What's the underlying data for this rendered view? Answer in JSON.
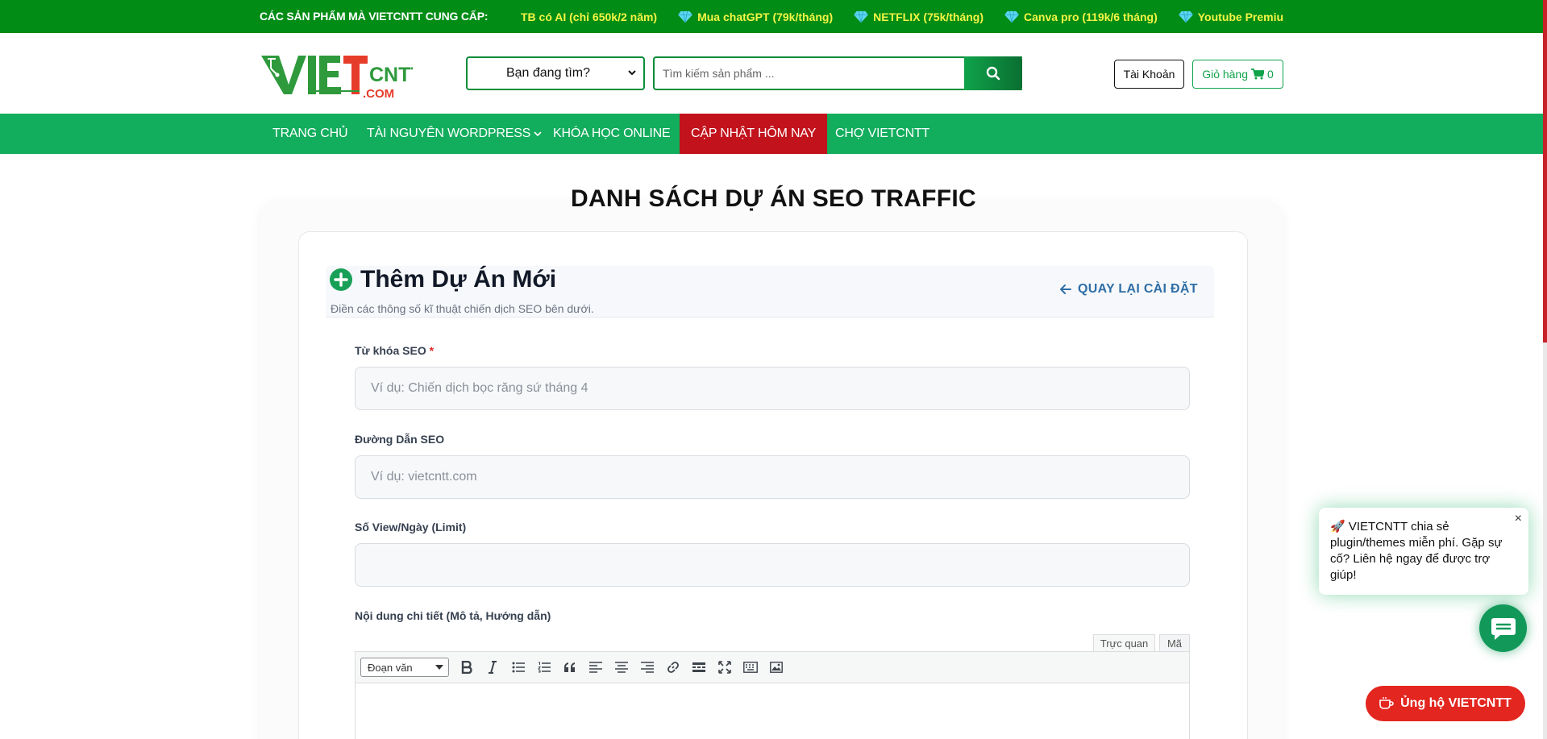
{
  "topbar": {
    "label": "CÁC SẢN PHẨM MÀ VIETCNTT CUNG CẤP:",
    "ticker": [
      "TB có AI (chỉ 650k/2 năm)",
      "Mua chatGPT (79k/tháng)",
      "NETFLIX (75k/tháng)",
      "Canva pro (119k/6 tháng)",
      "Youtube Premiu"
    ]
  },
  "header": {
    "logo_text": "VIETCNTT",
    "logo_sub": ".COM",
    "search_category": "Bạn đang tìm?",
    "search_placeholder": "Tìm kiếm sản phẩm ...",
    "account_label": "Tài Khoản",
    "cart_label": "Giỏ hàng",
    "cart_count": "0"
  },
  "nav": {
    "items": [
      "TRANG CHỦ",
      "TÀI NGUYÊN WORDPRESS",
      "KHÓA HỌC ONLINE",
      "CẬP NHẬT HÔM NAY",
      "CHỢ VIETCNTT"
    ]
  },
  "main": {
    "page_title": "DANH SÁCH DỰ ÁN SEO TRAFFIC",
    "add_title": "Thêm Dự Án Mới",
    "add_subtitle": "Điền các thông số kĩ thuật chiến dịch SEO bên dưới.",
    "back_label": "QUAY LẠI CÀI ĐẶT",
    "fields": {
      "keyword_label": "Từ khóa SEO",
      "keyword_required": "*",
      "keyword_placeholder": "Ví dụ: Chiến dịch bọc răng sứ tháng 4",
      "url_label": "Đường Dẫn SEO",
      "url_placeholder": "Ví dụ: vietcntt.com",
      "views_label": "Số View/Ngày (Limit)",
      "views_value": "",
      "content_label": "Nội dung chi tiết (Mô tả, Hướng dẫn)"
    },
    "editor": {
      "tab_visual": "Trực quan",
      "tab_code": "Mã",
      "format": "Đoạn văn"
    }
  },
  "chat": {
    "message": "🚀 VIETCNTT chia sẻ plugin/themes miễn phí. Gặp sự cố? Liên hệ ngay để được trợ giúp!",
    "close": "×",
    "donate_label": "Ủng hộ VIETCNTT"
  },
  "colors": {
    "topbar": "#008c15",
    "nav": "#12ad5d",
    "nav_active": "#c2121c",
    "accent_green": "#0fa34a",
    "donate": "#e3261f",
    "link": "#2f6ea6"
  }
}
